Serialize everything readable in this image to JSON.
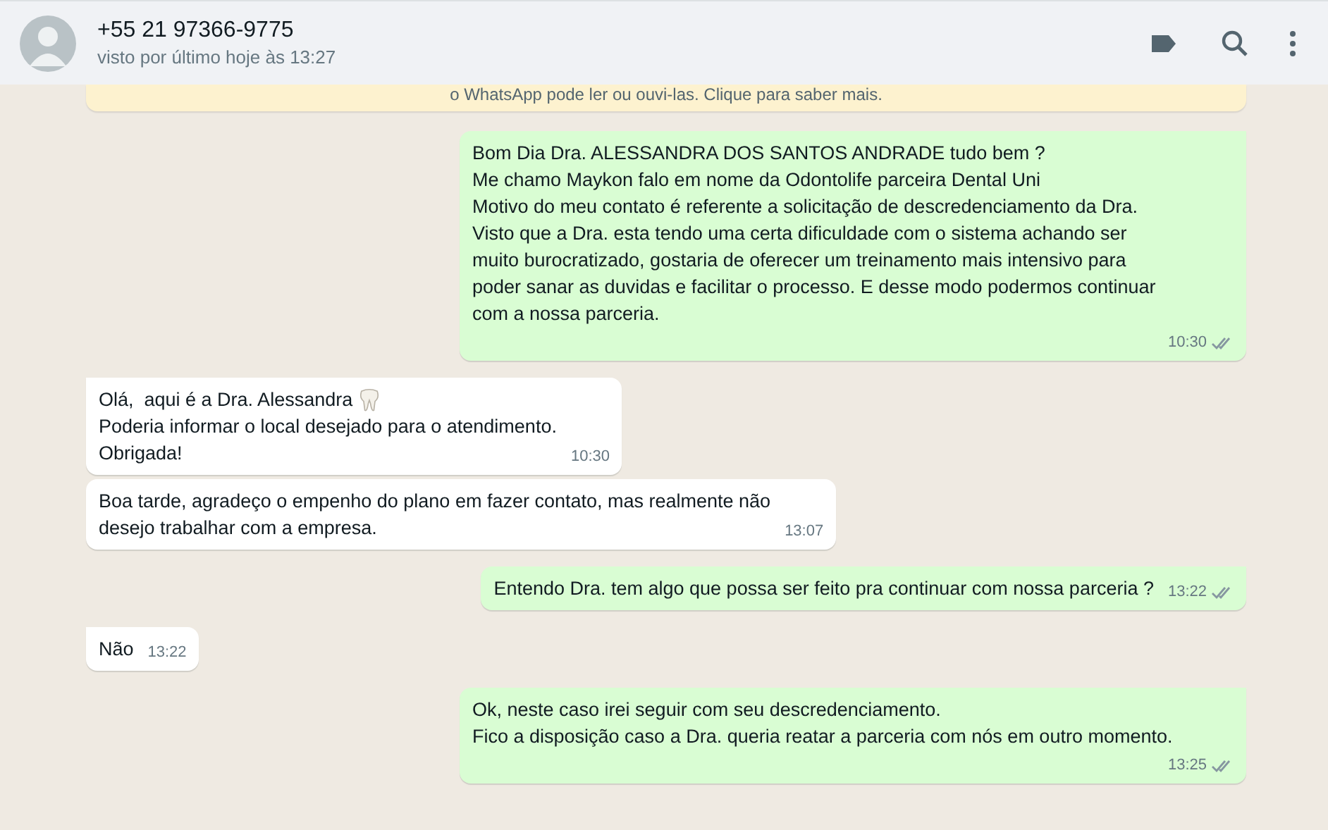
{
  "header": {
    "contact": "+55 21 97366-9775",
    "last_seen": "visto por último hoje às 13:27"
  },
  "banner": {
    "text": "o WhatsApp pode ler ou ouvi-las. Clique para saber mais."
  },
  "messages": [
    {
      "kind": "out",
      "tail": true,
      "lines": [
        "Bom Dia Dra. ALESSANDRA DOS SANTOS ANDRADE tudo bem ?",
        "Me chamo Maykon falo em nome da Odontolife parceira Dental Uni",
        "Motivo do meu contato é referente a solicitação de descredenciamento da Dra.",
        "Visto que a Dra. esta tendo uma certa dificuldade com o sistema achando ser",
        "muito burocratizado, gostaria de oferecer um treinamento mais intensivo para",
        "poder sanar as duvidas e facilitar o processo. E desse modo podermos continuar",
        "com a nossa parceria."
      ],
      "time": "10:30",
      "read": false
    },
    {
      "kind": "in",
      "tail": true,
      "emoji": true,
      "lines": [
        "Olá,  aqui é a Dra. Alessandra",
        "Poderia informar o local desejado para o atendimento.",
        "Obrigada!"
      ],
      "time": "10:30"
    },
    {
      "kind": "in",
      "tail": false,
      "lines": [
        "Boa tarde, agradeço o empenho do plano em fazer contato, mas realmente não",
        "desejo trabalhar com a empresa."
      ],
      "time": "13:07"
    },
    {
      "kind": "out",
      "tail": true,
      "lines": [
        "Entendo Dra. tem algo que possa ser feito pra continuar com nossa parceria ?"
      ],
      "time": "13:22",
      "read": false
    },
    {
      "kind": "in",
      "tail": true,
      "lines": [
        "Não"
      ],
      "time": "13:22"
    },
    {
      "kind": "out",
      "tail": true,
      "lines": [
        "Ok, neste caso irei seguir com seu descredenciamento.",
        "Fico a disposição caso a Dra. queria reatar a parceria com nós em outro momento."
      ],
      "time": "13:25",
      "read": false
    }
  ]
}
